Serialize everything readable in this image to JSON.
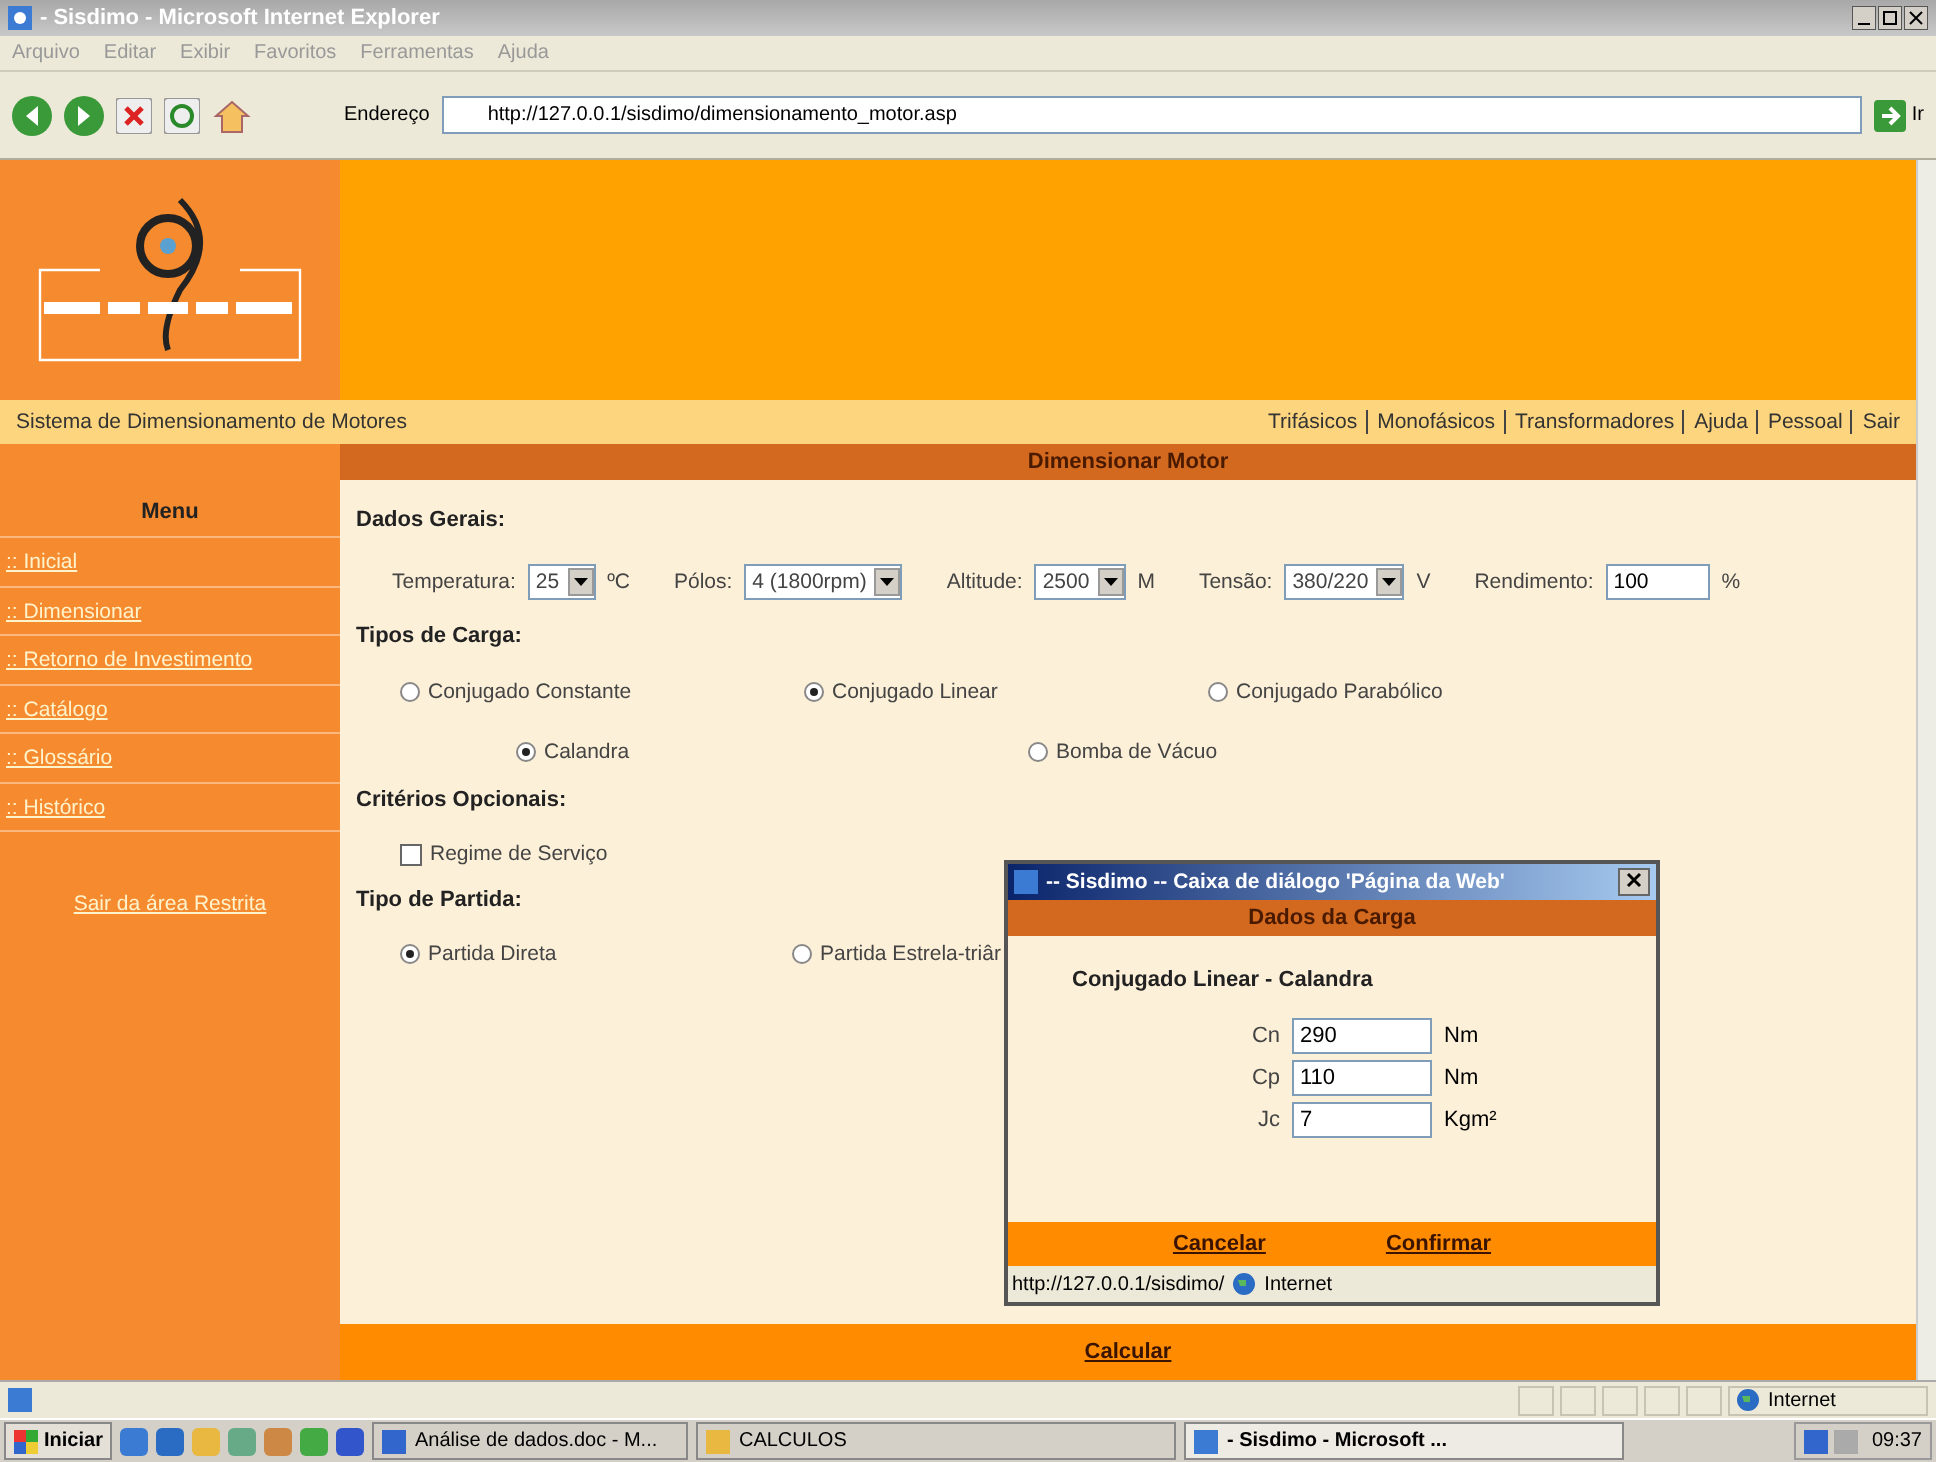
{
  "browser": {
    "title": "- Sisdimo - Microsoft Internet Explorer",
    "menu": [
      "Arquivo",
      "Editar",
      "Exibir",
      "Favoritos",
      "Ferramentas",
      "Ajuda"
    ],
    "address_label": "Endereço",
    "url": "http://127.0.0.1/sisdimo/dimensionamento_motor.asp",
    "go_label": "Ir"
  },
  "header": {
    "tagline": "Sistema de Dimensionamento de Motores",
    "nav": [
      "Trifásicos",
      "Monofásicos",
      "Transformadores",
      "Ajuda",
      "Pessoal",
      "Sair"
    ]
  },
  "sidebar": {
    "heading": "Menu",
    "items": [
      ":: Inicial",
      ":: Dimensionar",
      ":: Retorno de Investimento",
      ":: Catálogo",
      ":: Glossário",
      ":: Histórico"
    ],
    "logout": "Sair da área Restrita"
  },
  "page_title": "Dimensionar Motor",
  "dados_gerais": {
    "heading": "Dados Gerais:",
    "fields": [
      {
        "label": "Temperatura:",
        "kind": "select",
        "value": "25",
        "unit": "ºC"
      },
      {
        "label": "Pólos:",
        "kind": "select",
        "value": "4 (1800rpm)"
      },
      {
        "label": "Altitude:",
        "kind": "select",
        "value": "2500",
        "unit": "M"
      },
      {
        "label": "Tensão:",
        "kind": "select",
        "value": "380/220",
        "unit": "V"
      },
      {
        "label": "Rendimento:",
        "kind": "text",
        "value": "100",
        "unit": "%"
      }
    ]
  },
  "tipos_de_carga": {
    "heading": "Tipos de Carga:",
    "rows": [
      [
        {
          "label": "Conjugado Constante",
          "selected": false
        },
        {
          "label": "Conjugado Linear",
          "selected": true
        },
        {
          "label": "Conjugado Parabólico",
          "selected": false
        }
      ],
      [
        {
          "label": "Calandra",
          "selected": true
        },
        {
          "label": "Bomba de Vácuo",
          "selected": false
        }
      ]
    ]
  },
  "criterios": {
    "heading": "Critérios Opcionais:",
    "options": [
      {
        "label": "Regime de Serviço",
        "checked": false
      }
    ]
  },
  "tipo_partida": {
    "heading": "Tipo de Partida:",
    "options": [
      {
        "label": "Partida Direta",
        "selected": true
      },
      {
        "label": "Partida Estrela-triâr",
        "selected": false
      }
    ]
  },
  "calcular": "Calcular",
  "dialog": {
    "title": "-- Sisdimo -- Caixa de diálogo 'Página da Web'",
    "header": "Dados da Carga",
    "subtitle": "Conjugado Linear - Calandra",
    "fields": [
      {
        "label": "Cn",
        "value": "290",
        "unit": "Nm"
      },
      {
        "label": "Cp",
        "value": "110",
        "unit": "Nm"
      },
      {
        "label": "Jc",
        "value": "7",
        "unit": "Kgm²"
      }
    ],
    "buttons": [
      "Cancelar",
      "Confirmar"
    ],
    "status_url": "http://127.0.0.1/sisdimo/",
    "status_zone": "Internet"
  },
  "status_bar": {
    "zone": "Internet"
  },
  "taskbar": {
    "start": "Iniciar",
    "tasks": [
      {
        "label": "Análise de dados.doc - M...",
        "selected": false
      },
      {
        "label": "CALCULOS",
        "selected": false
      },
      {
        "label": "- Sisdimo - Microsoft ...",
        "selected": true
      }
    ],
    "clock": "09:37"
  }
}
